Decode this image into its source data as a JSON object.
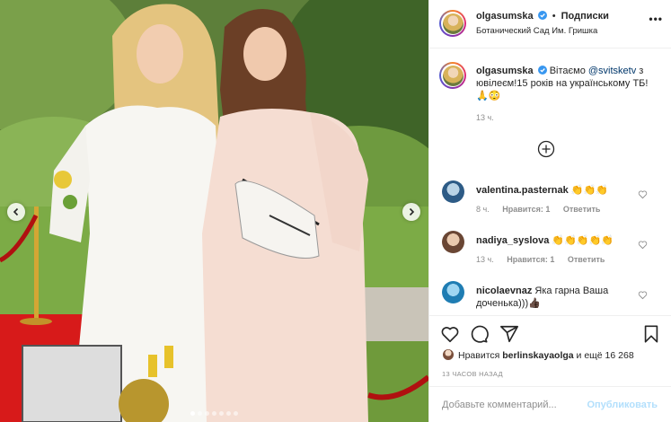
{
  "post": {
    "author": "olgasumska",
    "follow_separator": "•",
    "follow_label": "Подписки",
    "location": "Ботанический Сад Им. Гришка",
    "more_icon": "more-horizontal-icon",
    "caption": {
      "author": "olgasumska",
      "text_before": "Вітаємо ",
      "mention": "@svitsketv",
      "text_after": " з ювілеєм!15 років на українському ТБ!🙏😳",
      "time": "13 ч."
    }
  },
  "comments": [
    {
      "username": "valentina.pasternak",
      "text": "👏👏👏",
      "time": "8 ч.",
      "likes": "Нравится: 1",
      "reply": "Ответить"
    },
    {
      "username": "nadiya_syslova",
      "text": "👏👏👏👏👏",
      "time": "13 ч.",
      "likes": "Нравится: 1",
      "reply": "Ответить"
    },
    {
      "username": "nicolaevnaz",
      "text": "Яка гарна Ваша доченька)))👍🏿",
      "time": "",
      "likes": "",
      "reply": ""
    }
  ],
  "actions": {
    "like_icon": "heart-icon",
    "comment_icon": "comment-icon",
    "share_icon": "share-icon",
    "save_icon": "bookmark-icon"
  },
  "likes_summary": {
    "prefix": "Нравится ",
    "user": "berlinskayaolga",
    "suffix": " и ещё 16 268"
  },
  "post_time": "13 ЧАСОВ НАЗАД",
  "add_comment": {
    "placeholder": "Добавьте комментарий...",
    "publish_label": "Опубликовать"
  },
  "carousel": {
    "slide_count": 7,
    "active_index": 0
  },
  "colors": {
    "mention": "#00376b",
    "publish_disabled": "#b2dffc",
    "verified": "#3897f0"
  }
}
